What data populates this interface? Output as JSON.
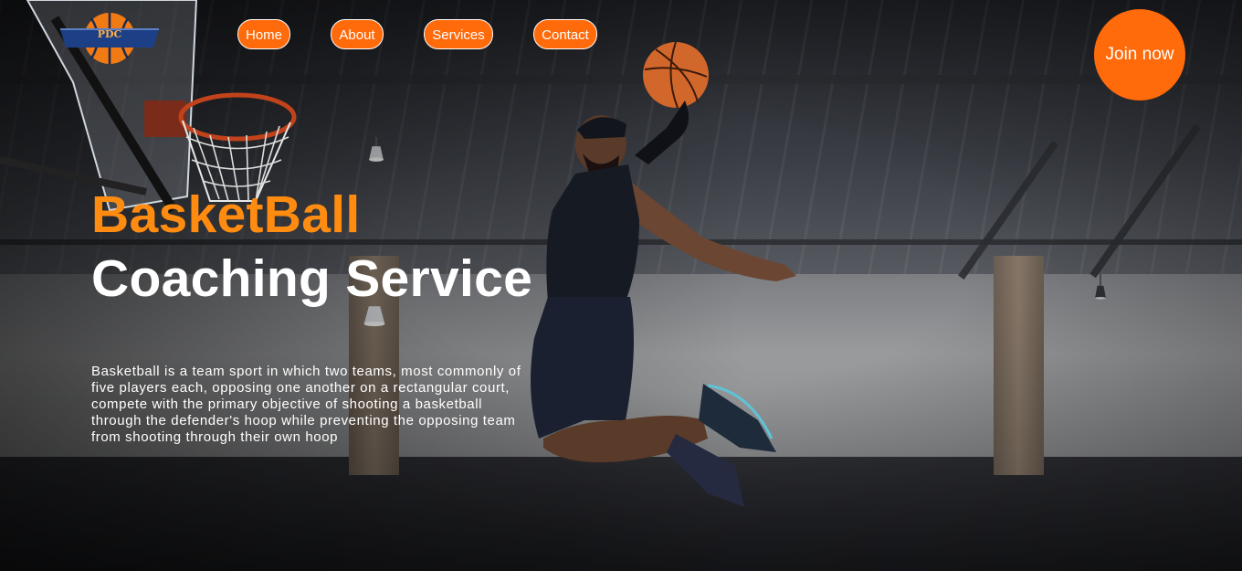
{
  "logo": {
    "text": "PDC"
  },
  "nav": {
    "home": "Home",
    "about": "About",
    "services": "Services",
    "contact": "Contact"
  },
  "cta": {
    "join_label": "Join now"
  },
  "hero": {
    "title_line1": "BasketBall",
    "title_line2": "Coaching Service",
    "description": "Basketball is a team sport in which two teams, most commonly of five players each, opposing one another on a rectangular court, compete with the primary objective of shooting a basketball through the defender's hoop while preventing the opposing team from shooting through their own hoop"
  },
  "colors": {
    "accent": "#ff6a0a",
    "title_highlight": "#ff8c10",
    "text": "#ffffff"
  }
}
